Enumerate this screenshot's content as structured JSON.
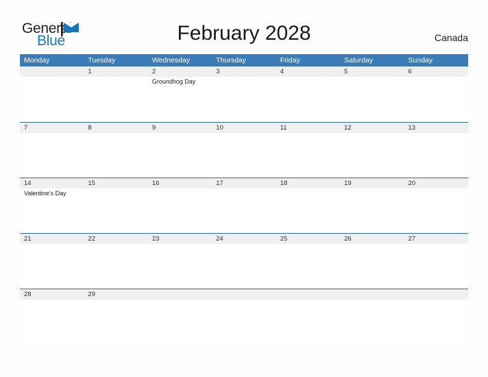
{
  "brand": {
    "name_part1": "General",
    "name_part2": "Blue",
    "flag_icon": "blue-flag-icon",
    "primary_color": "#1b75bb",
    "text_color": "#231f20"
  },
  "header": {
    "title": "February 2028",
    "country": "Canada"
  },
  "theme": {
    "header_blue": "#3b7cb8",
    "row_rule_blue": "#2f6ca5",
    "band_gray": "#f0f0f0",
    "page_background": "#fdfdfd",
    "day_number_color": "#1f2d3d"
  },
  "calendar": {
    "month": "February",
    "year": "2028",
    "weekday_headers": [
      "Monday",
      "Tuesday",
      "Wednesday",
      "Thursday",
      "Friday",
      "Saturday",
      "Sunday"
    ],
    "weeks": [
      [
        {
          "date": "",
          "events": []
        },
        {
          "date": "1",
          "events": []
        },
        {
          "date": "2",
          "events": [
            "Groundhog Day"
          ]
        },
        {
          "date": "3",
          "events": []
        },
        {
          "date": "4",
          "events": []
        },
        {
          "date": "5",
          "events": []
        },
        {
          "date": "6",
          "events": []
        }
      ],
      [
        {
          "date": "7",
          "events": []
        },
        {
          "date": "8",
          "events": []
        },
        {
          "date": "9",
          "events": []
        },
        {
          "date": "10",
          "events": []
        },
        {
          "date": "11",
          "events": []
        },
        {
          "date": "12",
          "events": []
        },
        {
          "date": "13",
          "events": []
        }
      ],
      [
        {
          "date": "14",
          "events": [
            "Valentine's Day"
          ]
        },
        {
          "date": "15",
          "events": []
        },
        {
          "date": "16",
          "events": []
        },
        {
          "date": "17",
          "events": []
        },
        {
          "date": "18",
          "events": []
        },
        {
          "date": "19",
          "events": []
        },
        {
          "date": "20",
          "events": []
        }
      ],
      [
        {
          "date": "21",
          "events": []
        },
        {
          "date": "22",
          "events": []
        },
        {
          "date": "23",
          "events": []
        },
        {
          "date": "24",
          "events": []
        },
        {
          "date": "25",
          "events": []
        },
        {
          "date": "26",
          "events": []
        },
        {
          "date": "27",
          "events": []
        }
      ],
      [
        {
          "date": "28",
          "events": []
        },
        {
          "date": "29",
          "events": []
        },
        {
          "date": "",
          "events": []
        },
        {
          "date": "",
          "events": []
        },
        {
          "date": "",
          "events": []
        },
        {
          "date": "",
          "events": []
        },
        {
          "date": "",
          "events": []
        }
      ]
    ]
  }
}
